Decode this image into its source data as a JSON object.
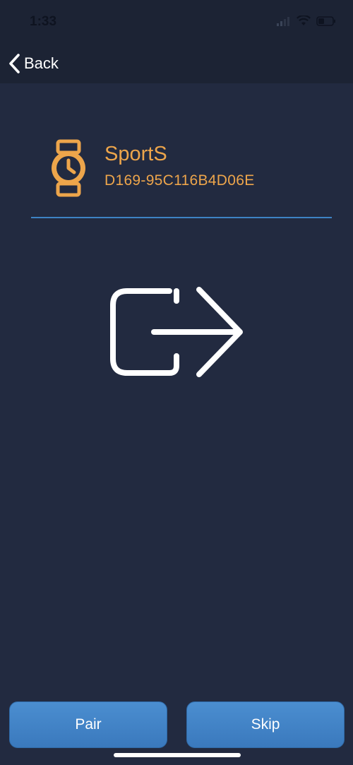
{
  "status_bar": {
    "time": "1:33",
    "icons": [
      "cellular-signal-icon",
      "wifi-icon",
      "battery-icon"
    ]
  },
  "nav": {
    "back_label": "Back",
    "back_icon": "chevron-left-icon"
  },
  "device": {
    "icon": "watch-icon",
    "name": "SportS",
    "id": "D169-95C116B4D06E"
  },
  "illustration": {
    "icon": "connect-arrow-icon"
  },
  "actions": {
    "pair_label": "Pair",
    "skip_label": "Skip"
  },
  "colors": {
    "background": "#222a40",
    "accent": "#eda54b",
    "divider": "#3d82c4",
    "button": "#4287cb"
  }
}
